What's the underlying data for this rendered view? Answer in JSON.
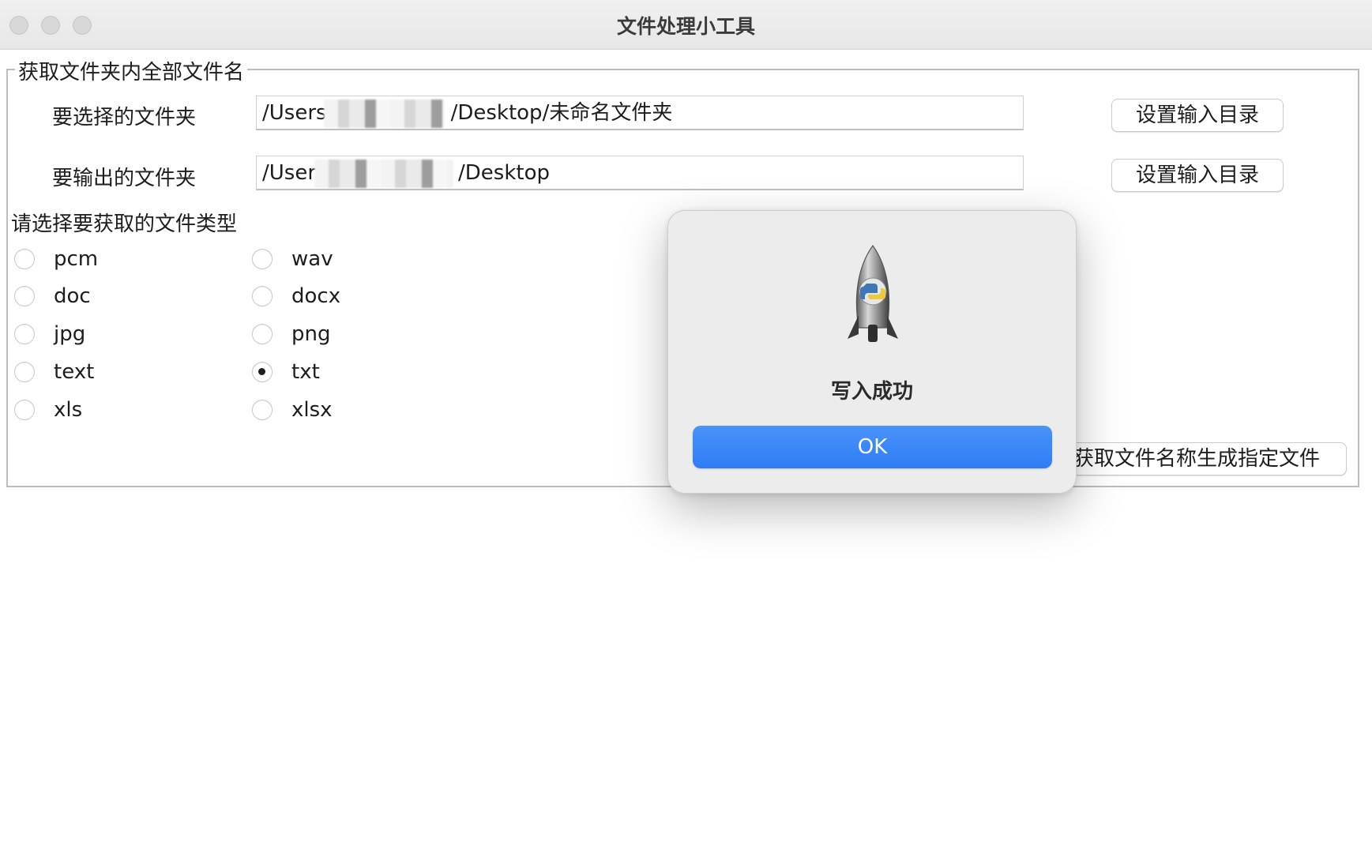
{
  "window": {
    "title": "文件处理小工具"
  },
  "group": {
    "legend": "获取文件夹内全部文件名"
  },
  "input_folder": {
    "label": "要选择的文件夹",
    "path_prefix": "/Users",
    "path_suffix": "/Desktop/未命名文件夹",
    "button_label": "设置输入目录"
  },
  "output_folder": {
    "label": "要输出的文件夹",
    "path_prefix": "/User",
    "path_suffix": "/Desktop",
    "button_label": "设置输入目录"
  },
  "file_types": {
    "label": "请选择要获取的文件类型",
    "options": [
      {
        "label": "pcm",
        "checked": false
      },
      {
        "label": "wav",
        "checked": false
      },
      {
        "label": "doc",
        "checked": false
      },
      {
        "label": "docx",
        "checked": false
      },
      {
        "label": "jpg",
        "checked": false
      },
      {
        "label": "png",
        "checked": false
      },
      {
        "label": "text",
        "checked": false
      },
      {
        "label": "txt",
        "checked": true
      },
      {
        "label": "xls",
        "checked": false
      },
      {
        "label": "xlsx",
        "checked": false
      }
    ]
  },
  "generate_button": {
    "label": "获取文件名称生成指定文件"
  },
  "alert": {
    "message": "写入成功",
    "ok_label": "OK",
    "icon": "python-launcher-rocket-icon"
  },
  "colors": {
    "accent": "#2f7cf6",
    "alert_background": "#ececec"
  }
}
